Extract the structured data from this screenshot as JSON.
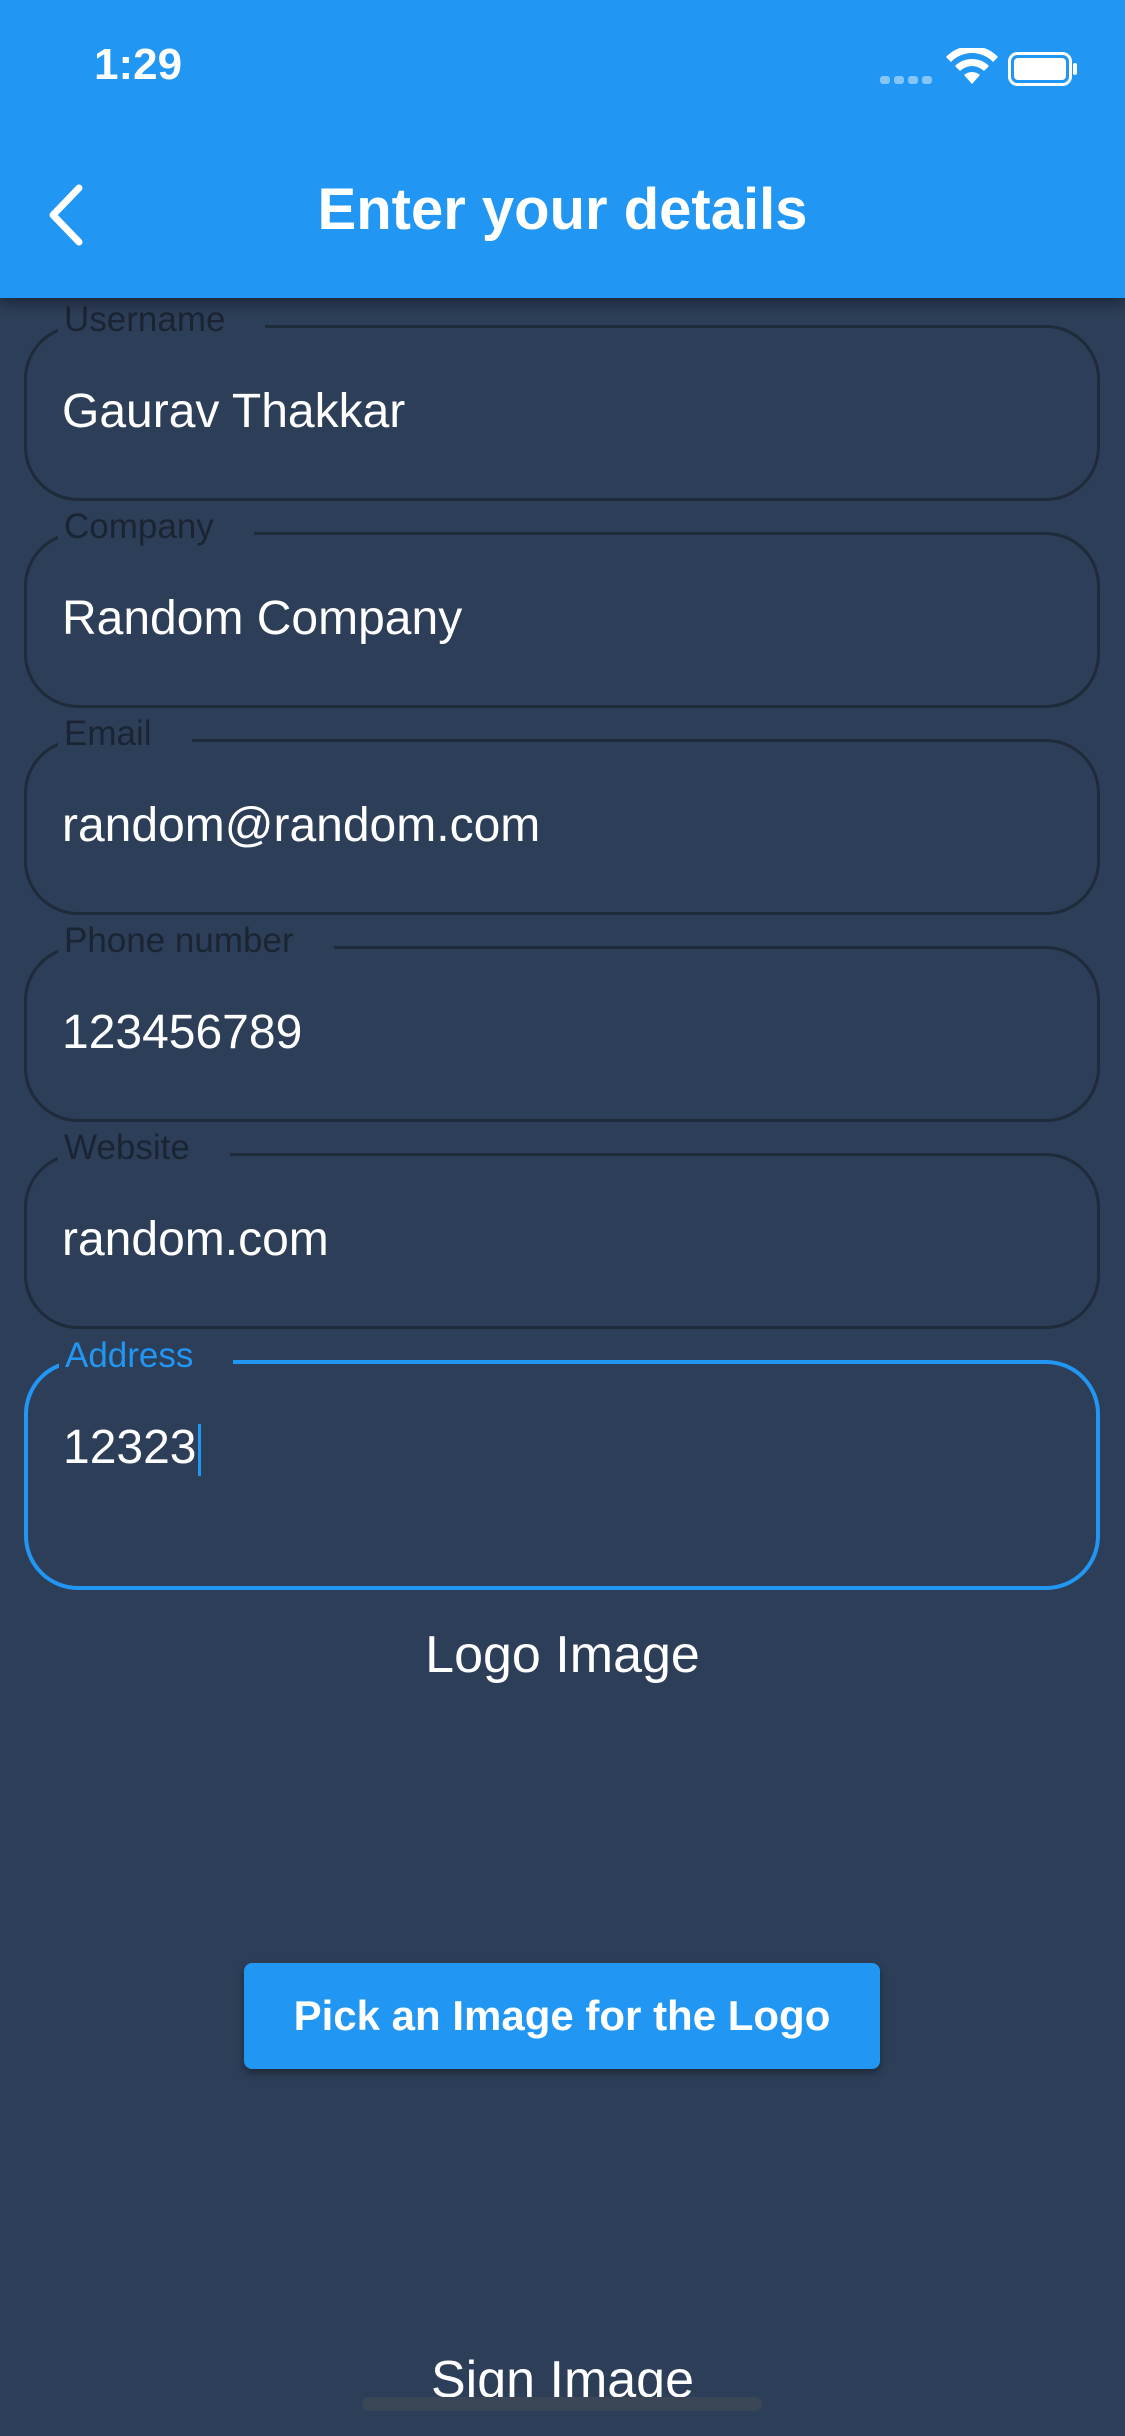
{
  "status_bar": {
    "time": "1:29"
  },
  "app_bar": {
    "title": "Enter your details"
  },
  "fields": [
    {
      "label": "Username",
      "value": "Gaurav Thakkar"
    },
    {
      "label": "Company",
      "value": "Random Company"
    },
    {
      "label": "Email",
      "value": "random@random.com"
    },
    {
      "label": "Phone number",
      "value": "123456789"
    },
    {
      "label": "Website",
      "value": "random.com"
    },
    {
      "label": "Address",
      "value": "12323"
    }
  ],
  "logo_section": {
    "title": "Logo Image",
    "button_label": "Pick an Image for the Logo"
  },
  "sign_section": {
    "title": "Sign Image"
  },
  "colors": {
    "accent": "#2196f3",
    "background": "#2d3e58"
  }
}
